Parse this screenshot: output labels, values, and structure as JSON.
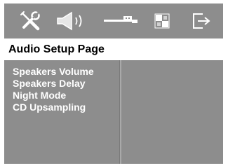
{
  "toolbar": {
    "icons": [
      "general-setup-icon",
      "audio-setup-icon",
      "video-setup-icon",
      "preference-setup-icon",
      "exit-icon"
    ]
  },
  "page": {
    "title": "Audio Setup Page"
  },
  "menu": {
    "items": [
      {
        "label": "Speakers Volume"
      },
      {
        "label": "Speakers Delay"
      },
      {
        "label": "Night Mode"
      },
      {
        "label": "CD Upsampling"
      }
    ]
  },
  "colors": {
    "panel": "#8d8d8d",
    "text_light": "#ffffff",
    "text_dark": "#000000",
    "background": "#ffffff"
  }
}
